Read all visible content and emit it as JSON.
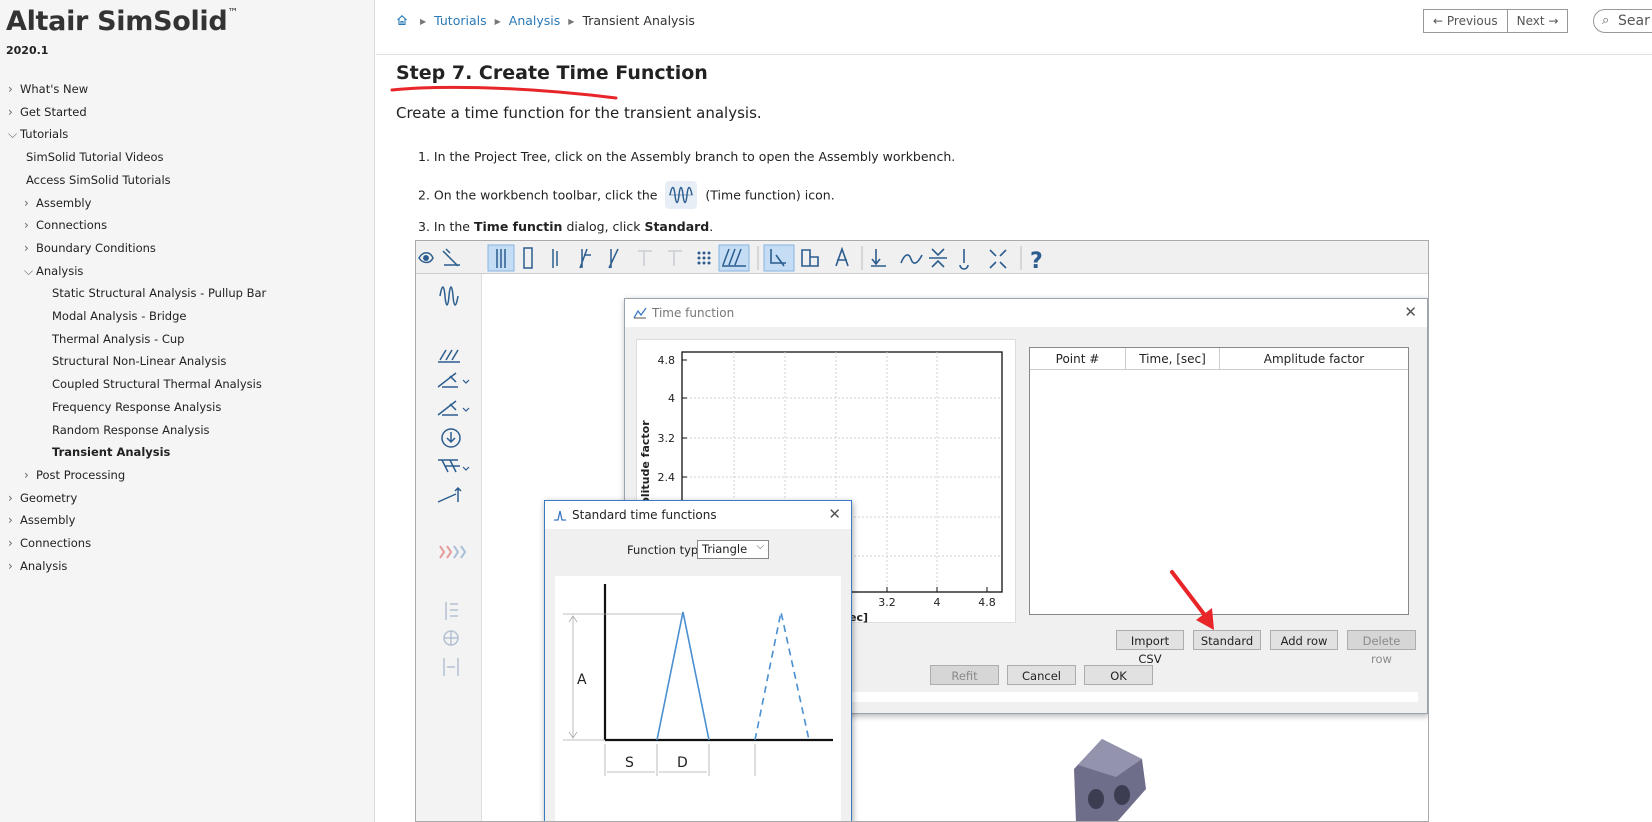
{
  "sidebar": {
    "brand": "Altair SimSolid",
    "brand_tm": "™",
    "version": "2020.1",
    "items": [
      {
        "label": "What's New",
        "level": 0,
        "expanded": false,
        "active": false
      },
      {
        "label": "Get Started",
        "level": 0,
        "expanded": false,
        "active": false
      },
      {
        "label": "Tutorials",
        "level": 0,
        "expanded": true,
        "active": false
      },
      {
        "label": "SimSolid Tutorial Videos",
        "level": 1,
        "leaf": true,
        "active": false
      },
      {
        "label": "Access SimSolid Tutorials",
        "level": 1,
        "leaf": true,
        "active": false
      },
      {
        "label": "Assembly",
        "level": 1,
        "expanded": false,
        "active": false
      },
      {
        "label": "Connections",
        "level": 1,
        "expanded": false,
        "active": false
      },
      {
        "label": "Boundary Conditions",
        "level": 1,
        "expanded": false,
        "active": false
      },
      {
        "label": "Analysis",
        "level": 1,
        "expanded": true,
        "active": false
      },
      {
        "label": "Static Structural Analysis - Pullup Bar",
        "level": 2,
        "leaf": true,
        "active": false
      },
      {
        "label": "Modal Analysis - Bridge",
        "level": 2,
        "leaf": true,
        "active": false
      },
      {
        "label": "Thermal Analysis - Cup",
        "level": 2,
        "leaf": true,
        "active": false
      },
      {
        "label": "Structural Non-Linear Analysis",
        "level": 2,
        "leaf": true,
        "active": false
      },
      {
        "label": "Coupled Structural Thermal Analysis",
        "level": 2,
        "leaf": true,
        "active": false
      },
      {
        "label": "Frequency Response Analysis",
        "level": 2,
        "leaf": true,
        "active": false
      },
      {
        "label": "Random Response Analysis",
        "level": 2,
        "leaf": true,
        "active": false
      },
      {
        "label": "Transient Analysis",
        "level": 2,
        "leaf": true,
        "active": true
      },
      {
        "label": "Post Processing",
        "level": 1,
        "expanded": false,
        "active": false
      },
      {
        "label": "Geometry",
        "level": 0,
        "expanded": false,
        "active": false
      },
      {
        "label": "Assembly",
        "level": 0,
        "expanded": false,
        "active": false
      },
      {
        "label": "Connections",
        "level": 0,
        "expanded": false,
        "active": false
      },
      {
        "label": "Analysis",
        "level": 0,
        "expanded": false,
        "active": false
      }
    ]
  },
  "header": {
    "breadcrumb": {
      "tutorials": "Tutorials",
      "analysis": "Analysis",
      "current": "Transient Analysis"
    },
    "previous": "← Previous",
    "next": "Next →",
    "search_value": "Sear"
  },
  "article": {
    "title": "Step 7. Create Time Function",
    "intro": "Create a time function for the transient analysis.",
    "step1": "1. In the Project Tree, click on the Assembly branch to open the Assembly workbench.",
    "step2_pre": "2. On the workbench toolbar, click the",
    "step2_post": "(Time function) icon.",
    "step3_pre": "3. In the",
    "step3_b1": "Time functin",
    "step3_mid": "dialog, click",
    "step3_b2": "Standard",
    "step3_end": "."
  },
  "time_function_dialog": {
    "title": "Time function",
    "close": "✕",
    "plot": {
      "ylabel": "plitude factor",
      "xlabel": "ec]",
      "y_ticks": [
        "4.8",
        "4",
        "3.2",
        "2.4"
      ],
      "x_ticks": [
        "3.2",
        "4",
        "4.8"
      ]
    },
    "table_headers": [
      "Point #",
      "Time, [sec]",
      "Amplitude factor"
    ],
    "buttons": {
      "import_csv": "Import CSV",
      "standard": "Standard",
      "add_row": "Add row",
      "delete_row": "Delete row"
    },
    "footer": {
      "refit": "Refit",
      "cancel": "Cancel",
      "ok": "OK"
    }
  },
  "standard_dialog": {
    "title": "Standard time functions",
    "close": "✕",
    "function_type_label": "Function type",
    "function_type_value": "Triangle",
    "labels": {
      "a": "A",
      "s": "S",
      "d": "D"
    }
  },
  "colors": {
    "link": "#2a7ab8",
    "annotation_red": "#e8262a",
    "sketch_blue": "#4a8fd0",
    "tool_blue": "#2c5d8f"
  }
}
